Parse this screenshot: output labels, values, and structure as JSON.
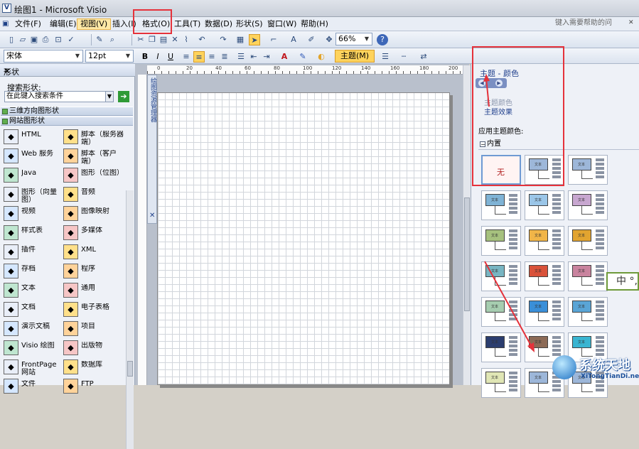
{
  "window": {
    "title": "绘图1 - Microsoft Visio",
    "title_icon": "visio-doc-icon"
  },
  "menu": {
    "items": [
      "文件(F)",
      "编辑(E)",
      "视图(V)",
      "插入(I)",
      "格式(O)",
      "工具(T)",
      "数据(D)",
      "形状(S)",
      "窗口(W)",
      "帮助(H)"
    ],
    "selected": "视图(V)",
    "help_placeholder": "键入需要帮助的问"
  },
  "toolbar": {
    "zoom": "66%"
  },
  "format_toolbar": {
    "font": "宋体",
    "size": "12pt",
    "bold": "B",
    "italic": "I",
    "underline": "U",
    "theme_button": "主题(M)"
  },
  "shapes_panel": {
    "title": "形状",
    "search_label": "搜索形状:",
    "search_placeholder": "在此键入搜索条件",
    "stencils": [
      "三维方向图形状",
      "网站图形状"
    ],
    "items": [
      {
        "label": "HTML",
        "icon": "html-globe-icon"
      },
      {
        "label": "脚本（服务器端）",
        "icon": "server-script-icon"
      },
      {
        "label": "Web 服务",
        "icon": "web-service-icon"
      },
      {
        "label": "脚本（客户端）",
        "icon": "client-script-icon"
      },
      {
        "label": "Java",
        "icon": "java-icon"
      },
      {
        "label": "图形（位图）",
        "icon": "bitmap-icon"
      },
      {
        "label": "图形（向量图）",
        "icon": "vector-graphic-icon"
      },
      {
        "label": "音频",
        "icon": "audio-icon"
      },
      {
        "label": "视频",
        "icon": "video-icon"
      },
      {
        "label": "图像映射",
        "icon": "image-map-icon"
      },
      {
        "label": "样式表",
        "icon": "stylesheet-icon"
      },
      {
        "label": "多媒体",
        "icon": "multimedia-icon"
      },
      {
        "label": "插件",
        "icon": "plugin-icon"
      },
      {
        "label": "XML",
        "icon": "xml-icon"
      },
      {
        "label": "存档",
        "icon": "archive-icon"
      },
      {
        "label": "程序",
        "icon": "program-icon"
      },
      {
        "label": "文本",
        "icon": "text-icon"
      },
      {
        "label": "通用",
        "icon": "generic-icon"
      },
      {
        "label": "文档",
        "icon": "word-doc-icon"
      },
      {
        "label": "电子表格",
        "icon": "spreadsheet-icon"
      },
      {
        "label": "演示文稿",
        "icon": "presentation-icon"
      },
      {
        "label": "项目",
        "icon": "project-icon"
      },
      {
        "label": "Visio 绘图",
        "icon": "visio-drawing-icon"
      },
      {
        "label": "出版物",
        "icon": "publisher-icon"
      },
      {
        "label": "FrontPage 网站",
        "icon": "frontpage-icon"
      },
      {
        "label": "数据库",
        "icon": "database-icon"
      },
      {
        "label": "文件",
        "icon": "file-icon"
      },
      {
        "label": "FTP",
        "icon": "ftp-icon"
      }
    ]
  },
  "ruler": {
    "labels": [
      "0",
      "20",
      "40",
      "60",
      "80",
      "100",
      "120",
      "140",
      "160",
      "180",
      "200"
    ]
  },
  "drawing_explorer": {
    "label": "绘图资源管理器"
  },
  "theme_panel": {
    "title": "主题 - 颜色",
    "link_colors": "主题颜色",
    "link_effects": "主题效果",
    "apply_label": "应用主题颜色:",
    "section": "内置",
    "none_label": "无",
    "thumb_text": "文本",
    "thumb_colors": [
      "#9db7d9",
      "#9db7d9",
      "#e7a33c",
      "#7fb3d5",
      "#9bc6e8",
      "#c8a7d0",
      "#8cc0c8",
      "#a6c17e",
      "#f1b548",
      "#e2a430",
      "#9dba5e",
      "#78b5c2",
      "#d9523a",
      "#c9839e",
      "#f08fc1",
      "#a6cdb0",
      "#3a8fd8",
      "#5aa5d6",
      "#c2b7a3",
      "#2b3d6e",
      "#8c6a56",
      "#3ab5d1",
      "#9bb0c2",
      "#e0e6b5"
    ]
  },
  "overlay": {
    "badge_text": "中 °,",
    "watermark_title": "系统天地",
    "watermark_url": "XiTongTianDi.net"
  }
}
